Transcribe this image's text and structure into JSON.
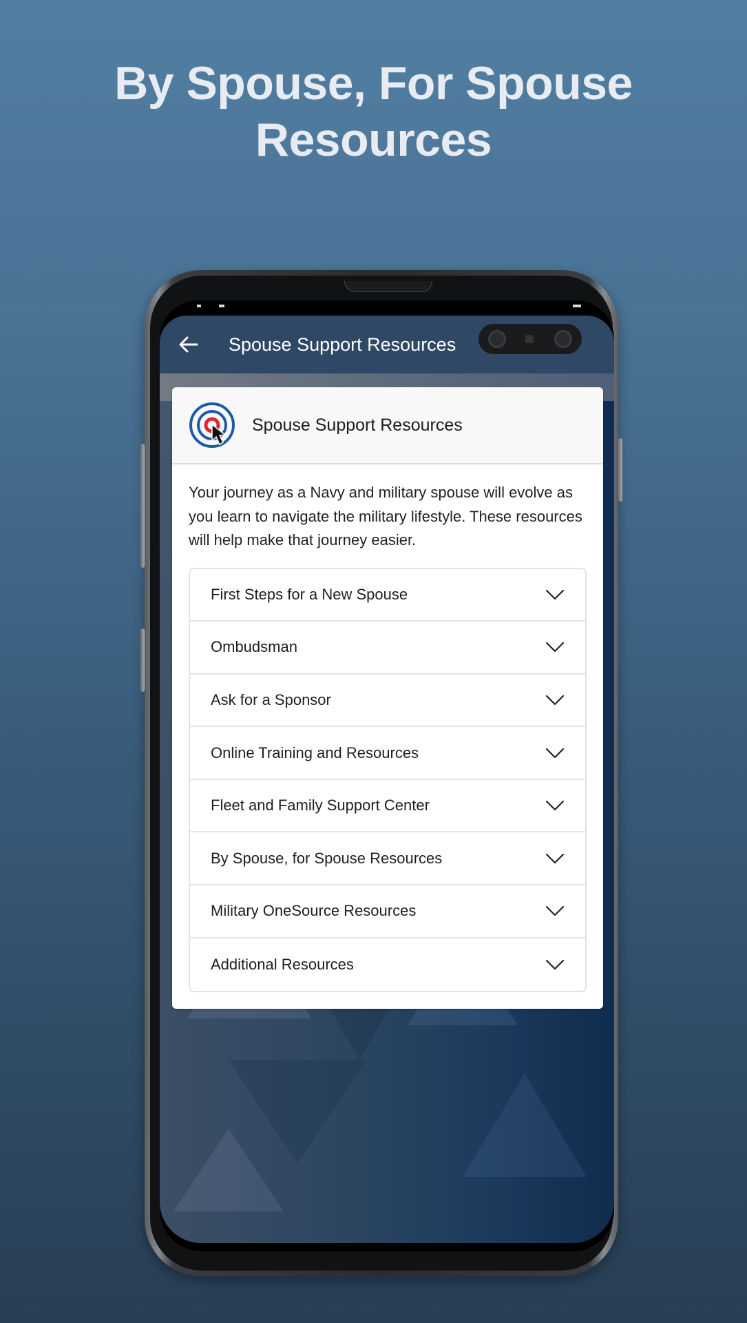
{
  "promo": {
    "headline_line1": "By Spouse, For Spouse",
    "headline_line2": "Resources"
  },
  "appbar": {
    "back_icon": "arrow-left-icon",
    "title": "Spouse Support Resources"
  },
  "card": {
    "logo_icon": "target-cursor-icon",
    "title": "Spouse Support Resources",
    "intro": "Your journey as a Navy and military spouse will evolve as you learn to navigate the military lifestyle. These resources will help make that journey easier.",
    "accordion": [
      {
        "label": "First Steps for a New Spouse",
        "icon": "chevron-down-icon",
        "expanded": false
      },
      {
        "label": "Ombudsman",
        "icon": "chevron-down-icon",
        "expanded": false
      },
      {
        "label": "Ask for a Sponsor",
        "icon": "chevron-down-icon",
        "expanded": false
      },
      {
        "label": "Online Training and Resources",
        "icon": "chevron-down-icon",
        "expanded": false
      },
      {
        "label": "Fleet and Family Support Center",
        "icon": "chevron-down-icon",
        "expanded": false
      },
      {
        "label": "By Spouse, for Spouse Resources",
        "icon": "chevron-down-icon",
        "expanded": false
      },
      {
        "label": "Military OneSource Resources",
        "icon": "chevron-down-icon",
        "expanded": false
      },
      {
        "label": "Additional Resources",
        "icon": "chevron-down-icon",
        "expanded": false
      }
    ]
  },
  "colors": {
    "logo_blue": "#1f5aa8",
    "logo_red": "#e0242f",
    "appbar": "#2f4866",
    "background_top": "#517ea2",
    "background_bottom": "#283e54"
  }
}
